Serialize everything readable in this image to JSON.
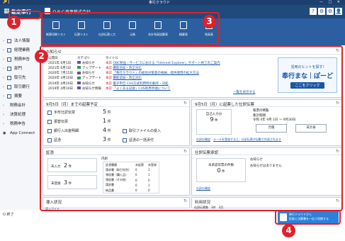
{
  "window": {
    "title": "奉行クラウド",
    "left_label": "🔑 J",
    "controls": "— □ ✕"
  },
  "appbar": {
    "grid_icon": "grid-icon",
    "product": "勘定奉行",
    "company": "ＯＢＣ商事株式会社",
    "right_icons": [
      "?",
      "⚙",
      "⚙",
      "👤"
    ]
  },
  "toolbar": {
    "items": [
      {
        "label": "帳票印刷リスト"
      },
      {
        "label": "伝票リスト"
      },
      {
        "label": "仕訳伝票入力"
      },
      {
        "label": "元帳"
      },
      {
        "label": "合計残高試算表"
      },
      {
        "label": "精算表"
      },
      {
        "label": "残高表"
      }
    ]
  },
  "sidebar": {
    "items": [
      {
        "label": "法人情報"
      },
      {
        "label": "経理業務"
      },
      {
        "label": "税務申告"
      },
      {
        "label": "部門"
      },
      {
        "label": "取引先"
      },
      {
        "label": "取引銀行"
      },
      {
        "label": "摘要"
      },
      {
        "label": "財務会計"
      },
      {
        "label": "決算処理"
      },
      {
        "label": "税務申告"
      },
      {
        "label": "App Connect"
      }
    ],
    "footer": "終了"
  },
  "notice": {
    "title": "お知らせ",
    "columns": [
      "公開日",
      "カテゴリ",
      "タイトル"
    ],
    "rows": [
      {
        "date": "2021年 6月1日",
        "color": "#6b4fa0",
        "cat": "お知らせ",
        "title": "OBC製品・サービスにおける「Internet Explorer」サポート終了のご案内"
      },
      {
        "date": "2021年 6月1日",
        "color": "#2d9a5a",
        "cat": "アップデート",
        "title": "機能追加・改正対応"
      },
      {
        "date": "2020年 7月15日",
        "color": "#6b4fa0",
        "cat": "お知らせ",
        "title": "「奉行クラウド」の総括対策意の格納、提供運用の拡大方法"
      },
      {
        "date": "2020年 4月10日",
        "color": "#2d9a5a",
        "cat": "アップデート",
        "title": "機能追加・改正対応"
      },
      {
        "date": "2019年 4月20日",
        "color": "#6b4fa0",
        "cat": "お知らせ",
        "title": "電子申告 CUS方式利用時の動作・対処"
      },
      {
        "date": "2019年 4月10日",
        "color": "#6b4fa0",
        "cat": "お知らせ情報",
        "title": "「よくある記録」CUS利用手順について"
      }
    ],
    "more": "一覧を表示する",
    "banner": {
      "line1": "活用のヒントを探す!",
      "line2": "奉行まな｜ぽーど",
      "button": "ここをクリック"
    }
  },
  "schedule": {
    "title": "9月5日（月）までの起票予定",
    "items": [
      {
        "label": "手形仕訳伝票",
        "value": "5",
        "unit": "件"
      },
      {
        "label": "振替伝票",
        "value": "1",
        "unit": "件"
      },
      {
        "label": "銀行入出金明細",
        "value": "4",
        "unit": "件"
      },
      {
        "label": "証憑",
        "value": "3",
        "unit": "件"
      }
    ],
    "right_items": [
      {
        "label": "取引ファイルの受入"
      },
      {
        "label": "証憑の一括添付"
      }
    ]
  },
  "ledger": {
    "title": "9月5日（月）に起票した仕訳伝票",
    "self_input_label": "自己入力分",
    "self_input_value": "9",
    "self_input_unit": "件",
    "period_label": "帳票の略覧",
    "period_sub": "集計期間",
    "period_from": "令和 4年 9月 1日",
    "period_to": "9月30日",
    "btn1": "元帳",
    "btn2": "日計表",
    "links": [
      "仕訳の確認",
      "ルールを登録すると、仕訳伝票が自動で作成されます"
    ]
  },
  "evidence": {
    "title": "証憑",
    "unlinked_label": "未入力",
    "unlinked_value": "2",
    "unlinked_unit": "件",
    "unregistered_label": "未登録",
    "unregistered_value": "3",
    "unregistered_unit": "件",
    "table_title": "内訳",
    "table_headers": [
      "証憑種類",
      "未起票",
      "未登録"
    ],
    "table_rows": [
      {
        "type": "請求書（取引先別）",
        "a": "0",
        "b": "1"
      },
      {
        "type": "領収書（購入品）",
        "a": "0",
        "b": "1"
      },
      {
        "type": "領収書（その他）",
        "a": "0",
        "b": "0"
      },
      {
        "type": "請求書",
        "a": "0",
        "b": "1"
      },
      {
        "type": "納品書",
        "a": "0",
        "b": "0"
      }
    ]
  },
  "approval": {
    "title": "仕訳伝票承認",
    "pending_label": "未承認伝票の件数",
    "pending_value": "0",
    "pending_unit": "件",
    "notice_title": "お知らせ",
    "notice_text": "お知らせはありません",
    "link": "仕訳の確認"
  },
  "adoption": {
    "title": "導入状況",
    "link": "導入ガイド"
  },
  "usage": {
    "title": "利用状況",
    "label": "仕訳伝票数",
    "value": "3件",
    "period": "3月"
  },
  "promo": {
    "line1": "奉行クラウドから",
    "line2": "役務と決算書を一括で同期する"
  },
  "callouts": [
    "1",
    "2",
    "3",
    "4"
  ]
}
